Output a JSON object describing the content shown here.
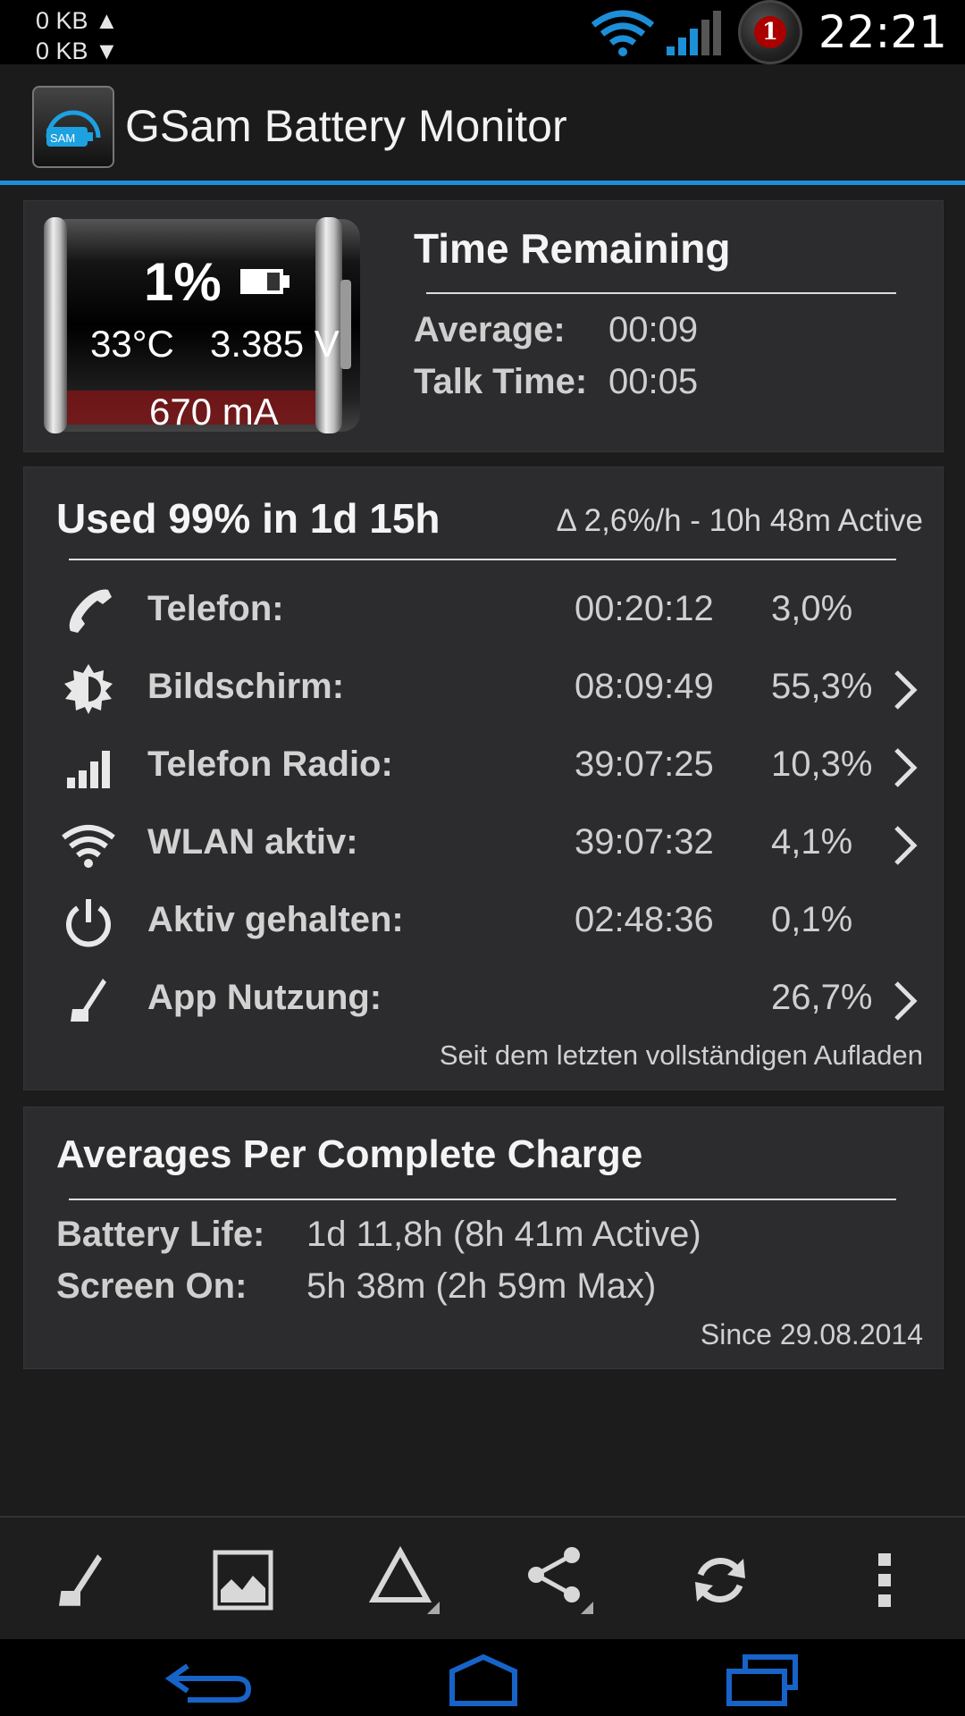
{
  "status_bar": {
    "upload_rate": "0 KB ▲",
    "download_rate": "0 KB ▼",
    "notification_count": "1",
    "time": "22:21"
  },
  "app": {
    "title": "GSam Battery Monitor",
    "icon_text": "SAM"
  },
  "battery": {
    "percent": "1%",
    "temperature": "33°C",
    "voltage": "3.385 V",
    "current": "670 mA"
  },
  "time_remaining": {
    "title": "Time Remaining",
    "average_label": "Average:",
    "average_value": "00:09",
    "talk_label": "Talk Time:",
    "talk_value": "00:05"
  },
  "usage": {
    "title": "Used 99% in 1d 15h",
    "delta": "Δ 2,6%/h - 10h 48m Active",
    "footer": "Seit dem letzten vollständigen Aufladen",
    "rows": [
      {
        "label": "Telefon:",
        "time": "00:20:12",
        "percent": "3,0%",
        "icon": "phone-icon"
      },
      {
        "label": "Bildschirm:",
        "time": "08:09:49",
        "percent": "55,3%",
        "icon": "brightness-icon"
      },
      {
        "label": "Telefon Radio:",
        "time": "39:07:25",
        "percent": "10,3%",
        "icon": "signal-bars-icon"
      },
      {
        "label": "WLAN aktiv:",
        "time": "39:07:32",
        "percent": "4,1%",
        "icon": "wifi-icon"
      },
      {
        "label": "Aktiv gehalten:",
        "time": "02:48:36",
        "percent": "0,1%",
        "icon": "power-icon"
      },
      {
        "label": "App Nutzung:",
        "time": "",
        "percent": "26,7%",
        "icon": "app-usage-icon"
      }
    ]
  },
  "averages": {
    "title": "Averages Per Complete Charge",
    "battery_life_label": "Battery Life:",
    "battery_life_value": "1d 11,8h (8h 41m Active)",
    "screen_on_label": "Screen On:",
    "screen_on_value": "5h 38m (2h 59m Max)",
    "since": "Since 29.08.2014"
  },
  "colors": {
    "accent": "#1d8fd8",
    "card": "#2c2c2e",
    "background": "#1c1c1d"
  }
}
